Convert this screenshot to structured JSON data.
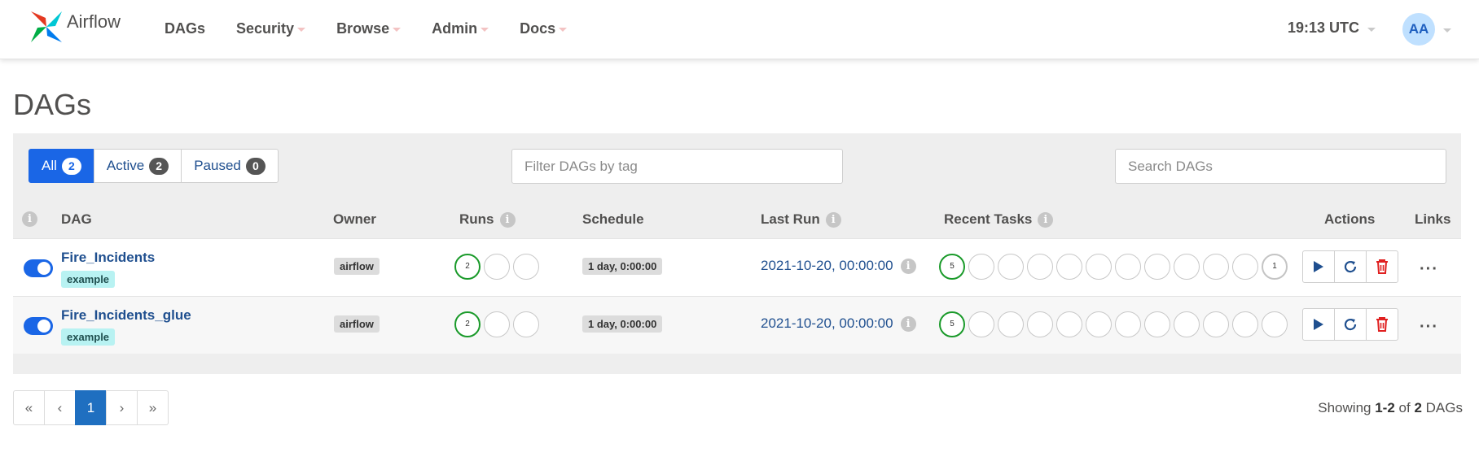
{
  "app": {
    "brand": "Airflow"
  },
  "nav": {
    "items": [
      {
        "label": "DAGs",
        "dropdown": false
      },
      {
        "label": "Security",
        "dropdown": true
      },
      {
        "label": "Browse",
        "dropdown": true
      },
      {
        "label": "Admin",
        "dropdown": true
      },
      {
        "label": "Docs",
        "dropdown": true
      }
    ],
    "clock": "19:13 UTC",
    "user_initials": "AA"
  },
  "page": {
    "title": "DAGs"
  },
  "filters": {
    "status": [
      {
        "label": "All",
        "count": "2",
        "active": true
      },
      {
        "label": "Active",
        "count": "2",
        "active": false
      },
      {
        "label": "Paused",
        "count": "0",
        "active": false
      }
    ],
    "tag_placeholder": "Filter DAGs by tag",
    "search_placeholder": "Search DAGs"
  },
  "table": {
    "columns": {
      "dag": "DAG",
      "owner": "Owner",
      "runs": "Runs",
      "schedule": "Schedule",
      "last_run": "Last Run",
      "recent_tasks": "Recent Tasks",
      "actions": "Actions",
      "links": "Links"
    },
    "rows": [
      {
        "name": "Fire_Incidents",
        "tag": "example",
        "owner": "airflow",
        "enabled": true,
        "runs": [
          "2",
          "",
          ""
        ],
        "schedule": "1 day, 0:00:00",
        "last_run": "2021-10-20, 00:00:00",
        "recent_tasks": [
          "5",
          "",
          "",
          "",
          "",
          "",
          "",
          "",
          "",
          "",
          "",
          "1"
        ],
        "links": "···"
      },
      {
        "name": "Fire_Incidents_glue",
        "tag": "example",
        "owner": "airflow",
        "enabled": true,
        "runs": [
          "2",
          "",
          ""
        ],
        "schedule": "1 day, 0:00:00",
        "last_run": "2021-10-20, 00:00:00",
        "recent_tasks": [
          "5",
          "",
          "",
          "",
          "",
          "",
          "",
          "",
          "",
          "",
          "",
          ""
        ],
        "links": "···"
      }
    ]
  },
  "pagination": {
    "first": "«",
    "prev": "‹",
    "current": "1",
    "next": "›",
    "last": "»"
  },
  "footer": {
    "showing_prefix": "Showing",
    "range": "1-2",
    "of": "of",
    "total": "2",
    "suffix": "DAGs"
  },
  "colors": {
    "accent": "#1a66e6",
    "success": "#1a9a2a",
    "delete": "#e02020",
    "link": "#1f4f8f"
  }
}
